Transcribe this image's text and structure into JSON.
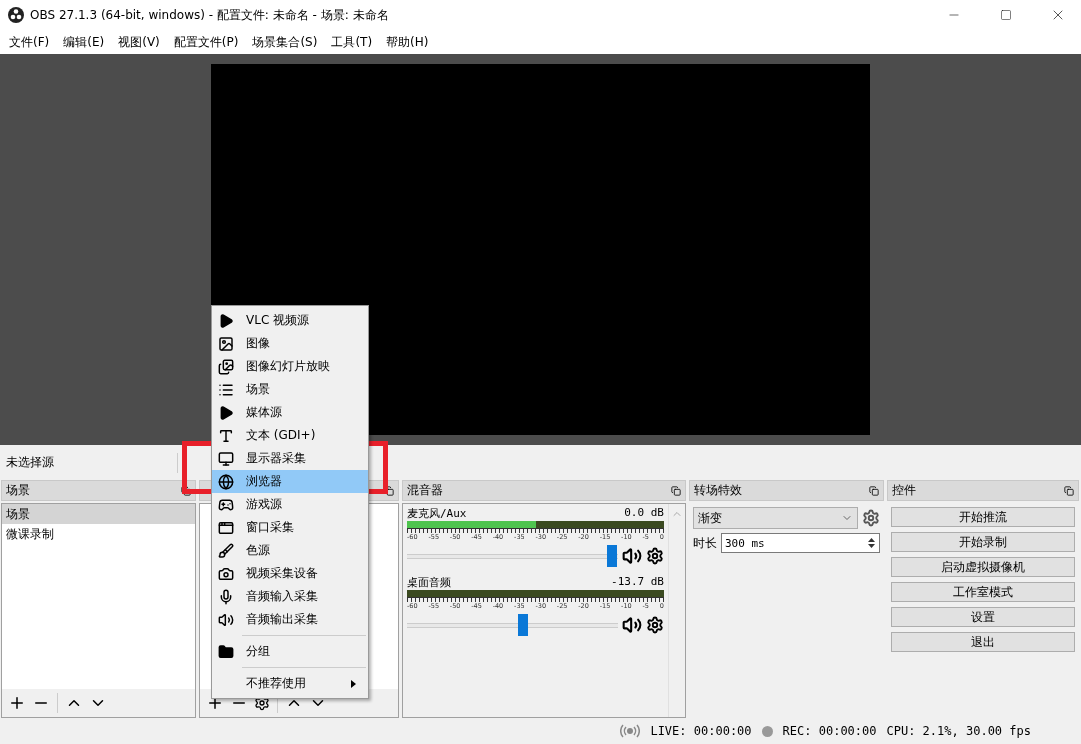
{
  "window": {
    "title": "OBS 27.1.3 (64-bit, windows) - 配置文件: 未命名 - 场景: 未命名"
  },
  "menu_bar": [
    "文件(F)",
    "编辑(E)",
    "视图(V)",
    "配置文件(P)",
    "场景集合(S)",
    "工具(T)",
    "帮助(H)"
  ],
  "source_bar": {
    "label": "未选择源"
  },
  "scenes": {
    "title": "场景",
    "items": [
      {
        "label": "场景",
        "selected": true
      },
      {
        "label": "微课录制",
        "selected": false
      }
    ]
  },
  "add_source_menu": {
    "sections": [
      [
        {
          "label": "VLC 视频源",
          "kind": "play",
          "selected": false
        },
        {
          "label": "图像",
          "kind": "image",
          "selected": false
        },
        {
          "label": "图像幻灯片放映",
          "kind": "slideshow",
          "selected": false
        },
        {
          "label": "场景",
          "kind": "list",
          "selected": false
        },
        {
          "label": "媒体源",
          "kind": "play",
          "selected": false
        },
        {
          "label": "文本 (GDI+)",
          "kind": "text",
          "selected": false
        },
        {
          "label": "显示器采集",
          "kind": "monitor",
          "selected": false
        },
        {
          "label": "浏览器",
          "kind": "globe",
          "selected": true
        },
        {
          "label": "游戏源",
          "kind": "gamepad",
          "selected": false
        },
        {
          "label": "窗口采集",
          "kind": "window",
          "selected": false
        },
        {
          "label": "色源",
          "kind": "brush",
          "selected": false
        },
        {
          "label": "视频采集设备",
          "kind": "camera",
          "selected": false
        },
        {
          "label": "音频输入采集",
          "kind": "mic",
          "selected": false
        },
        {
          "label": "音频输出采集",
          "kind": "speaker",
          "selected": false
        }
      ],
      [
        {
          "label": "分组",
          "kind": "folder",
          "selected": false
        }
      ],
      [
        {
          "label": "不推荐使用",
          "kind": "submenu",
          "selected": false
        }
      ]
    ]
  },
  "mixer": {
    "title": "混音器",
    "channels": [
      {
        "name": "麦克风/Aux",
        "reading": "0.0 dB",
        "meter": {
          "level": 0.5
        },
        "level": 0.97,
        "scale": [
          "-60",
          "-55",
          "-50",
          "-45",
          "-40",
          "-35",
          "-30",
          "-25",
          "-20",
          "-15",
          "-10",
          "-5",
          "0"
        ]
      },
      {
        "name": "桌面音频",
        "reading": "-13.7 dB",
        "level": 0.55,
        "scale": [
          "-60",
          "-55",
          "-50",
          "-45",
          "-40",
          "-35",
          "-30",
          "-25",
          "-20",
          "-15",
          "-10",
          "-5",
          "0"
        ]
      }
    ]
  },
  "transitions": {
    "title": "转场特效",
    "type": "渐变",
    "duration_label": "时长",
    "duration": "300 ms"
  },
  "controls": {
    "title": "控件",
    "buttons": [
      "开始推流",
      "开始录制",
      "启动虚拟摄像机",
      "工作室模式",
      "设置",
      "退出"
    ]
  },
  "status_bar": {
    "live": "LIVE: 00:00:00",
    "rec": "REC: 00:00:00",
    "cpu": "CPU: 2.1%, 30.00 fps"
  }
}
